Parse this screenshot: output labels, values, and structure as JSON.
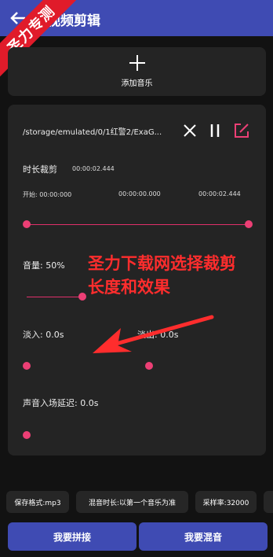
{
  "app": {
    "title": "视频剪辑",
    "badge_text": "圣力专测"
  },
  "add_music": {
    "label": "添加音乐"
  },
  "editor": {
    "file_path": "/storage/emulated/0/1红警2/ExaG...",
    "duration_section": {
      "title": "时长裁剪",
      "total": "00:00:02.444",
      "start_label": "开始: 00:00:000",
      "mid_time": "00:00:00.000",
      "end_time": "00:00:02.444",
      "range": [
        0,
        1
      ]
    },
    "volume": {
      "label": "音量: 50%",
      "value": 0.5
    },
    "fade_in": {
      "label": "淡入: 0.0s",
      "value": 0
    },
    "fade_out": {
      "label": "淡出: 0.0s",
      "value": 0
    },
    "delay": {
      "label": "声音入场延迟: 0.0s",
      "value": 0
    }
  },
  "overlay": {
    "line1": "圣力下载网选择裁剪",
    "line2": "长度和效果"
  },
  "settings": {
    "format": "保存格式:mp3",
    "mix_duration": "混音时长:以第一个音乐为准",
    "sample_rate": "采样率:32000"
  },
  "buttons": {
    "concat": "我要拼接",
    "mix": "我要混音"
  },
  "colors": {
    "accent": "#ec3f75",
    "primary": "#3f4bb3",
    "watermark": "#ff2d2d"
  }
}
